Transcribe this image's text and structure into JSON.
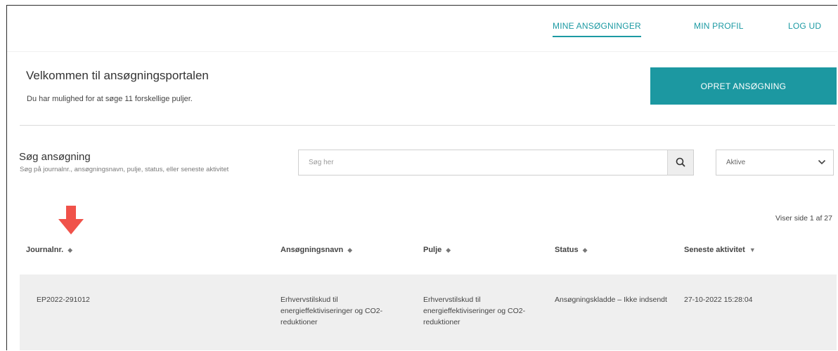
{
  "nav": {
    "items": [
      {
        "label": "MINE ANSØGNINGER",
        "active": true
      },
      {
        "label": "MIN PROFIL",
        "active": false
      },
      {
        "label": "LOG UD",
        "active": false
      }
    ]
  },
  "welcome": {
    "title": "Velkommen til ansøgningsportalen",
    "subtitle": "Du har mulighed for at søge 11 forskellige puljer."
  },
  "create_button": {
    "label": "OPRET ANSØGNING"
  },
  "search": {
    "title": "Søg ansøgning",
    "hint": "Søg på journalnr., ansøgningsnavn, pulje, status, eller seneste aktivitet",
    "placeholder": "Søg her",
    "icon": "search-icon"
  },
  "status_filter": {
    "selected": "Aktive",
    "icon": "chevron-down-icon"
  },
  "pagination": {
    "text": "Viser side 1 af 27"
  },
  "table": {
    "columns": [
      {
        "label": "Journalnr.",
        "sort": "◆"
      },
      {
        "label": "Ansøgningsnavn",
        "sort": "◆"
      },
      {
        "label": "Pulje",
        "sort": "◆"
      },
      {
        "label": "Status",
        "sort": "◆"
      },
      {
        "label": "Seneste aktivitet",
        "sort": "▼"
      }
    ],
    "rows": [
      {
        "journalnr": "EP2022-291012",
        "name": "Erhvervstilskud til energieffektiviseringer og CO2-reduktioner",
        "pulje": "Erhvervstilskud til energieffektiviseringer og CO2-reduktioner",
        "status": "Ansøgningskladde – Ikke indsendt",
        "activity": "27-10-2022 15:28:04"
      }
    ]
  },
  "colors": {
    "accent": "#1c98a1",
    "annotation_arrow": "#f0524a"
  }
}
